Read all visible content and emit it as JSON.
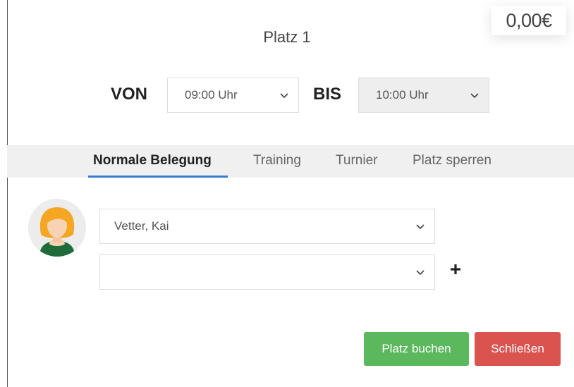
{
  "price": "0,00€",
  "title": "Platz 1",
  "time": {
    "from_label": "VON",
    "from_value": "09:00 Uhr",
    "to_label": "BIS",
    "to_value": "10:00 Uhr"
  },
  "tabs": [
    {
      "label": "Normale Belegung",
      "active": true
    },
    {
      "label": "Training"
    },
    {
      "label": "Turnier"
    },
    {
      "label": "Platz sperren"
    }
  ],
  "players": {
    "player1": "Vetter, Kai",
    "player2": ""
  },
  "buttons": {
    "book": "Platz buchen",
    "close": "Schließen"
  },
  "colors": {
    "accent": "#3a7bd5",
    "book": "#5cb85c",
    "close": "#d9534f"
  }
}
